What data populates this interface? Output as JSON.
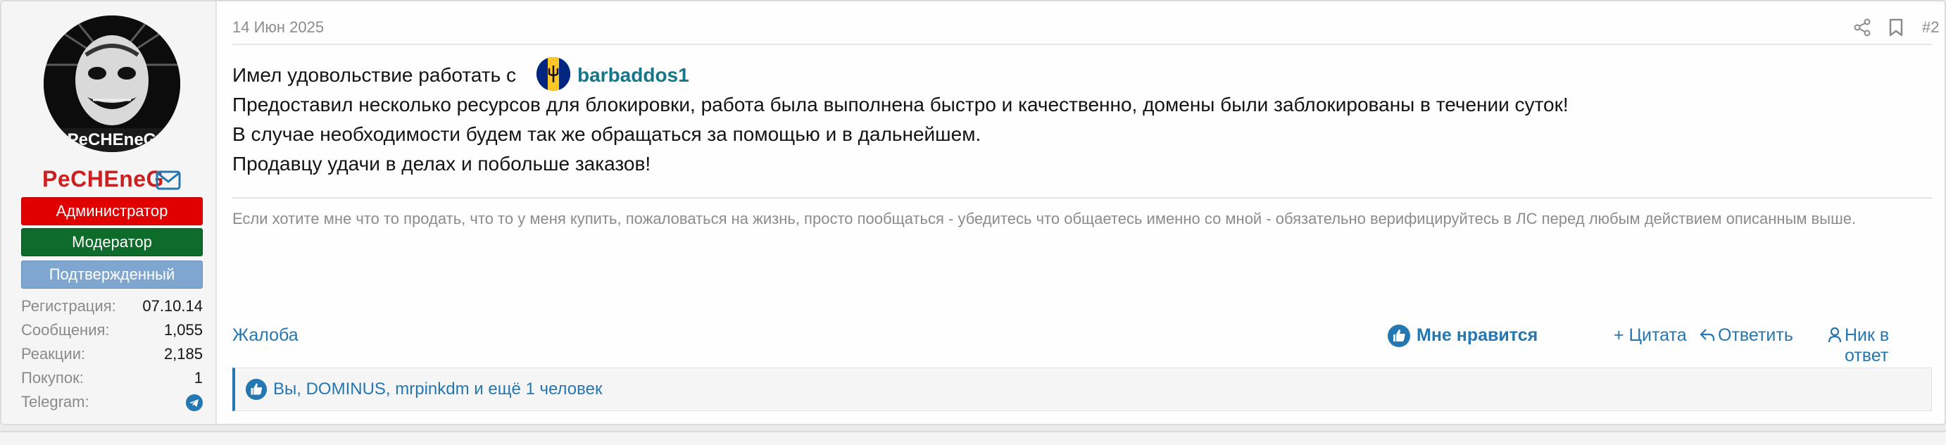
{
  "post": {
    "date": "14 Июн 2025",
    "number": "#2",
    "author": {
      "name": "PeCHEneG",
      "avatar_text": "PeCHEneG",
      "banners": {
        "admin": "Администратор",
        "moderator": "Модератор",
        "verified": "Подтвержденный"
      },
      "stats": [
        {
          "label": "Регистрация:",
          "value": "07.10.14"
        },
        {
          "label": "Сообщения:",
          "value": "1,055"
        },
        {
          "label": "Реакции:",
          "value": "2,185"
        },
        {
          "label": "Покупок:",
          "value": "1"
        },
        {
          "label": "Telegram:",
          "value": ""
        }
      ]
    },
    "body": {
      "intro": "Имел удовольствие работать с",
      "mention": "barbaddos1",
      "lines": [
        "Предоставил несколько ресурсов для блокировки, работа была выполнена быстро и качественно, домены были заблокированы в течении суток!",
        "В случае необходимости будем так же обращаться за помощью и в дальнейшем.",
        "Продавцу удачи в делах и побольше заказов!"
      ]
    },
    "signature": "Если хотите мне что то продать, что то у меня купить, пожаловаться на жизнь, просто пообщаться - убедитесь что общаетесь именно со мной - обязательно верифицируйтесь в ЛС перед любым действием описанным выше.",
    "actions": {
      "report": "Жалоба",
      "like": "Мне нравится",
      "quote": "+ Цитата",
      "reply": "Ответить",
      "mention": "Ник в ответ"
    },
    "reactions": "Вы, DOMINUS, mrpinkdm и ещё 1 человек"
  },
  "icons": {
    "mail": "mail-icon",
    "telegram": "telegram-icon",
    "share": "share-icon",
    "bookmark": "bookmark-icon",
    "like": "thumbs-up-icon",
    "reply": "reply-icon",
    "mention": "user-icon"
  },
  "colors": {
    "username": "#cc1f1f",
    "admin_banner": "#e00000",
    "moderator_banner": "#0f6b2c",
    "verified_banner": "#7fa6cf",
    "link": "#2577b1",
    "mention": "#14768b"
  }
}
